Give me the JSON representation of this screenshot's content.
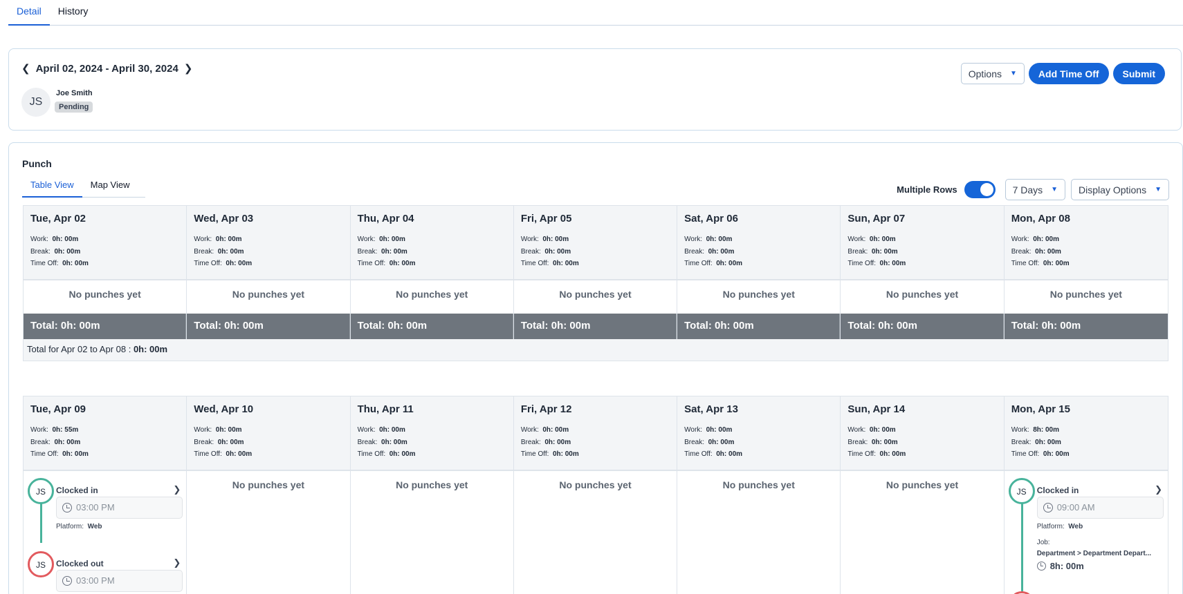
{
  "tabs": [
    {
      "label": "Detail",
      "active": true
    },
    {
      "label": "History",
      "active": false
    }
  ],
  "header": {
    "date_range": "April 02, 2024 - April 30, 2024",
    "avatar_initials": "JS",
    "employee_name": "Joe Smith",
    "status": "Pending",
    "options_label": "Options",
    "add_time_off_label": "Add Time Off",
    "submit_label": "Submit"
  },
  "punch": {
    "title": "Punch",
    "view_tabs": [
      {
        "label": "Table View",
        "active": true
      },
      {
        "label": "Map View",
        "active": false
      }
    ],
    "multiple_rows_label": "Multiple Rows",
    "multiple_rows_on": true,
    "days_select": "7 Days",
    "display_options_label": "Display Options"
  },
  "labels": {
    "work": "Work:",
    "break": "Break:",
    "time_off": "Time Off:",
    "no_punches": "No punches yet",
    "platform": "Platform:",
    "job": "Job:"
  },
  "weeks": [
    {
      "days": [
        {
          "title": "Tue, Apr 02",
          "work": "0h: 00m",
          "break": "0h: 00m",
          "time_off": "0h: 00m",
          "total": "Total: 0h: 00m"
        },
        {
          "title": "Wed, Apr 03",
          "work": "0h: 00m",
          "break": "0h: 00m",
          "time_off": "0h: 00m",
          "total": "Total: 0h: 00m"
        },
        {
          "title": "Thu, Apr 04",
          "work": "0h: 00m",
          "break": "0h: 00m",
          "time_off": "0h: 00m",
          "total": "Total: 0h: 00m"
        },
        {
          "title": "Fri, Apr 05",
          "work": "0h: 00m",
          "break": "0h: 00m",
          "time_off": "0h: 00m",
          "total": "Total: 0h: 00m"
        },
        {
          "title": "Sat, Apr 06",
          "work": "0h: 00m",
          "break": "0h: 00m",
          "time_off": "0h: 00m",
          "total": "Total: 0h: 00m"
        },
        {
          "title": "Sun, Apr 07",
          "work": "0h: 00m",
          "break": "0h: 00m",
          "time_off": "0h: 00m",
          "total": "Total: 0h: 00m"
        },
        {
          "title": "Mon, Apr 08",
          "work": "0h: 00m",
          "break": "0h: 00m",
          "time_off": "0h: 00m",
          "total": "Total: 0h: 00m"
        }
      ],
      "week_total_label": "Total for Apr 02 to Apr 08 :",
      "week_total_value": "0h: 00m"
    },
    {
      "days": [
        {
          "title": "Tue, Apr 09",
          "work": "0h: 55m",
          "break": "0h: 00m",
          "time_off": "0h: 00m"
        },
        {
          "title": "Wed, Apr 10",
          "work": "0h: 00m",
          "break": "0h: 00m",
          "time_off": "0h: 00m"
        },
        {
          "title": "Thu, Apr 11",
          "work": "0h: 00m",
          "break": "0h: 00m",
          "time_off": "0h: 00m"
        },
        {
          "title": "Fri, Apr 12",
          "work": "0h: 00m",
          "break": "0h: 00m",
          "time_off": "0h: 00m"
        },
        {
          "title": "Sat, Apr 13",
          "work": "0h: 00m",
          "break": "0h: 00m",
          "time_off": "0h: 00m"
        },
        {
          "title": "Sun, Apr 14",
          "work": "0h: 00m",
          "break": "0h: 00m",
          "time_off": "0h: 00m"
        },
        {
          "title": "Mon, Apr 15",
          "work": "8h: 00m",
          "break": "0h: 00m",
          "time_off": "0h: 00m"
        }
      ],
      "apr09_punches": {
        "in_initials": "JS",
        "in_label": "Clocked in",
        "in_time": "03:00 PM",
        "in_platform": "Web",
        "out_initials": "JS",
        "out_label": "Clocked out",
        "out_time": "03:00 PM"
      },
      "apr15_punches": {
        "in_initials": "JS",
        "in_label": "Clocked in",
        "in_time": "09:00 AM",
        "in_platform": "Web",
        "job": "Department > Department Depart...",
        "duration": "8h: 00m"
      }
    }
  ],
  "colors": {
    "accent": "#1565d8",
    "clock_in": "#48b39b",
    "clock_out": "#e25a5e",
    "total_bar": "#6e757d"
  },
  "icons": {
    "prev": "chevron-left-icon",
    "next": "chevron-right-icon",
    "caret": "caret-down-icon",
    "clock": "clock-icon"
  }
}
